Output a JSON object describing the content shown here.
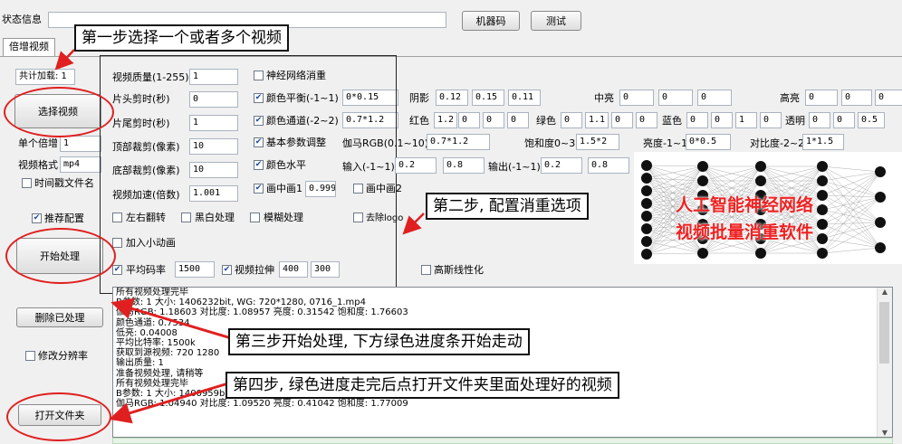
{
  "top": {
    "status_label": "状态信息",
    "status_value": "",
    "machine_code_button": "机器码",
    "test_button": "测试"
  },
  "tab": {
    "label": "倍增视频"
  },
  "left": {
    "total_label": "共计加载: 1",
    "select_button": "选择视频",
    "single_label": "单个倍增",
    "single_value": "1",
    "format_label": "视频格式",
    "format_value": "mp4",
    "timestamp_label": "时间戳文件名",
    "recommend_label": "推荐配置",
    "start_button": "开始处理",
    "delete_button": "删除已处理",
    "resolution_label": "修改分辨率",
    "open_folder_button": "打开文件夹"
  },
  "settings": {
    "quality_label": "视频质量(1-255)",
    "quality_value": "1",
    "head_label": "片头剪时(秒)",
    "head_value": "0",
    "tail_label": "片尾剪时(秒)",
    "tail_value": "1",
    "top_crop_label": "顶部裁剪(像素)",
    "top_crop_value": "10",
    "bottom_crop_label": "底部裁剪(像素)",
    "bottom_crop_value": "10",
    "speed_label": "视频加速(倍数)",
    "speed_value": "1.001",
    "flip_label": "左右翻转",
    "bw_label": "黑白处理",
    "blur_label": "模糊处理",
    "logo_label": "去除logo",
    "add_anim_label": "加入小动画",
    "bitrate_label": "平均码率",
    "bitrate_value": "1500",
    "stretch_label": "视频拉伸",
    "stretch_w": "400",
    "stretch_h": "300",
    "gauss_label": "高斯线性化",
    "nn_label": "神经网络消重",
    "balance_label": "颜色平衡(-1~1)",
    "balance_value": "0*0.15",
    "channel_label": "颜色通道(-2~2)",
    "channel_value": "0.7*1.2",
    "basic_label": "基本参数调整",
    "hlevel_label": "颜色水平",
    "pip1_label": "画中画1",
    "pip1_value": "0.999",
    "pip2_label": "画中画2",
    "gamma_label": "伽马RGB(0.1~10)",
    "gamma_value": "0.7*1.2",
    "sat_label": "饱和度0~3",
    "sat_value": "1.5*2",
    "bright_label": "亮度-1~1",
    "bright_value": "0*0.5",
    "contrast_label": "对比度-2~2",
    "contrast_value": "1*1.5",
    "input_label": "输入(-1~1)",
    "input_v1": "0.2",
    "input_v2": "0.8",
    "output_label": "输出(-1~1)",
    "output_v1": "0.2",
    "output_v2": "0.8",
    "shadow_label": "阴影",
    "shadow_v": [
      "0.12",
      "0.15",
      "0.11"
    ],
    "mid_label": "中亮",
    "mid_v": [
      "0",
      "0",
      "0"
    ],
    "high_label": "高亮",
    "high_v": [
      "0",
      "0",
      "0"
    ],
    "red_label": "红色",
    "red_v": [
      "1.2",
      "0",
      "0",
      "0"
    ],
    "green_label": "绿色",
    "green_v": [
      "0",
      "1.1",
      "0",
      "0"
    ],
    "blue_label": "蓝色",
    "blue_v": [
      "0",
      "0",
      "1",
      "0"
    ],
    "alpha_label": "透明",
    "alpha_v": [
      "0",
      "0",
      "0.5"
    ]
  },
  "banner": {
    "line1": "人工智能神经网络",
    "line2": "视频批量消重软件"
  },
  "log_lines": [
    "所有视频处理完毕",
    "B参数: 1  大小: 1406232bit, WG: 720*1280,  0716_1.mp4",
    "伽马RGB: 1.18603 对比度: 1.08957 亮度: 0.31542 饱和度: 1.76603",
    "颜色通道: 0.7534",
    "低亮: 0.04008",
    "平均比特率: 1500k",
    "获取到源视频: 720  1280",
    "输出质量: 1",
    "准备视频处理, 请稍等",
    "所有视频处理完毕",
    "B参数: 1  大小: 1400959bit, WG: 720*1280,  0716_1.mp4",
    "伽马RGB: 1.04940 对比度: 1.09520 亮度: 0.41042 饱和度: 1.77009"
  ],
  "annotations": {
    "step1": "第一步选择一个或者多个视频",
    "step2": "第二步, 配置消重选项",
    "step3": "第三步开始处理, 下方绿色进度条开始走动",
    "step4": "第四步, 绿色进度走完后点打开文件夹里面处理好的视频"
  },
  "colors": {
    "annotation_red": "#e02020",
    "banner_red": "#ee2222",
    "check_blue": "#1b4aa0"
  }
}
